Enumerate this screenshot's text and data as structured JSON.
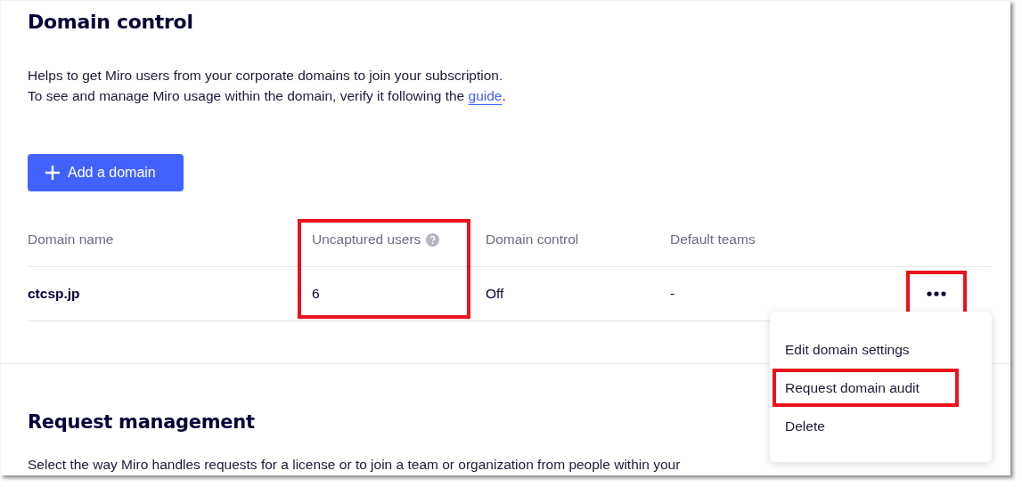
{
  "domain_control": {
    "title": "Domain control",
    "description": [
      {
        "text": "Helps to get Miro users from your corporate domains to join your subscription."
      },
      {
        "text": "To see and manage Miro usage within the domain, verify it following the ",
        "link": "guide",
        "after": "."
      }
    ],
    "add_button": {
      "label": "Add a domain"
    },
    "table": {
      "columns": [
        {
          "label": "Domain name",
          "highlighted": false,
          "info_icon": false
        },
        {
          "label": "Uncaptured users",
          "highlighted": true,
          "info_icon": true
        },
        {
          "label": "Domain control",
          "highlighted": false,
          "info_icon": false
        },
        {
          "label": "Default teams",
          "highlighted": false,
          "info_icon": false
        }
      ],
      "rows": [
        {
          "cells": [
            "ctcsp.jp",
            "6",
            "Off",
            "-"
          ],
          "more_button": {
            "highlighted": true
          }
        }
      ]
    }
  },
  "row_menu": {
    "items": [
      {
        "label": "Edit domain settings",
        "highlighted": false
      },
      {
        "label": "Request domain audit",
        "highlighted": true
      },
      {
        "label": "Delete",
        "highlighted": false
      }
    ]
  },
  "request_management": {
    "title": "Request management",
    "description": "Select the way Miro handles requests for a license or to join a team or organization from people within your"
  }
}
